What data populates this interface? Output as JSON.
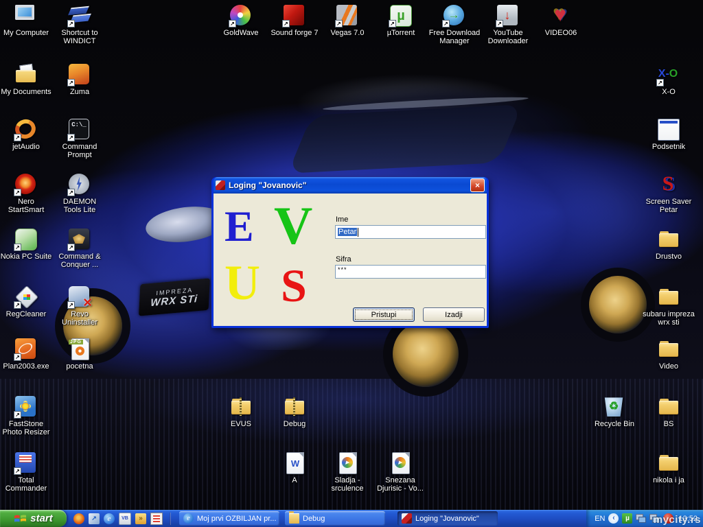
{
  "icons": {
    "my_computer": "My Computer",
    "windict": "Shortcut to WINDICT",
    "my_documents": "My Documents",
    "zuma": "Zuma",
    "jetaudio": "jetAudio",
    "command_prompt": "Command Prompt",
    "nero": "Nero StartSmart",
    "daemon": "DAEMON Tools Lite",
    "nokia": "Nokia PC Suite",
    "cnc": "Command & Conquer ...",
    "regcleaner": "RegCleaner",
    "revo": "Revo Uninstaller",
    "plan2003": "Plan2003.exe",
    "pocetna": "pocetna",
    "faststone": "FastStone Photo Resizer",
    "total_commander": "Total Commander",
    "goldwave": "GoldWave",
    "soundforge": "Sound forge 7",
    "vegas": "Vegas 7.0",
    "utorrent": "µTorrent",
    "fdm": "Free Download Manager",
    "ytd": "YouTube Downloader",
    "video06": "VIDEO06",
    "xo": "X-O",
    "podsetnik": "Podsetnik",
    "screensaver": "Screen Saver Petar",
    "drustvo": "Drustvo",
    "subaru": "subaru impreza wrx sti",
    "video": "Video",
    "recycle": "Recycle Bin",
    "bs": "BS",
    "nikola": "nikola i ja",
    "evus": "EVUS",
    "debug": "Debug",
    "a": "A",
    "sladja": "Sladja - srculence",
    "snezana": "Snezana Djurisic - Vo..."
  },
  "background": {
    "badge_line1": "IMPREZA",
    "badge_line2": "WRX STi"
  },
  "dialog": {
    "title": "Loging \"Jovanovic\"",
    "logo": {
      "e": "E",
      "v": "V",
      "u": "U",
      "s": "S"
    },
    "name_label": "Ime",
    "name_value": "Petar",
    "password_label": "Sifra",
    "password_value": "***",
    "submit_label": "Pristupi",
    "exit_label": "Izadji"
  },
  "taskbar": {
    "start_label": "start",
    "tasks": [
      {
        "label": "Moj prvi OZBILJAN pr..."
      },
      {
        "label": "Debug"
      },
      {
        "label": "Loging \"Jovanovic\""
      }
    ],
    "tray": {
      "language": "EN",
      "time": "13:52"
    }
  },
  "watermark": "mycity.rs",
  "colors": {
    "taskbar_blue": "#245edb",
    "titlebar_blue": "#0a49d2",
    "selection_blue": "#316ac5",
    "start_green": "#3f9a30",
    "dialog_face": "#ece9d8"
  }
}
